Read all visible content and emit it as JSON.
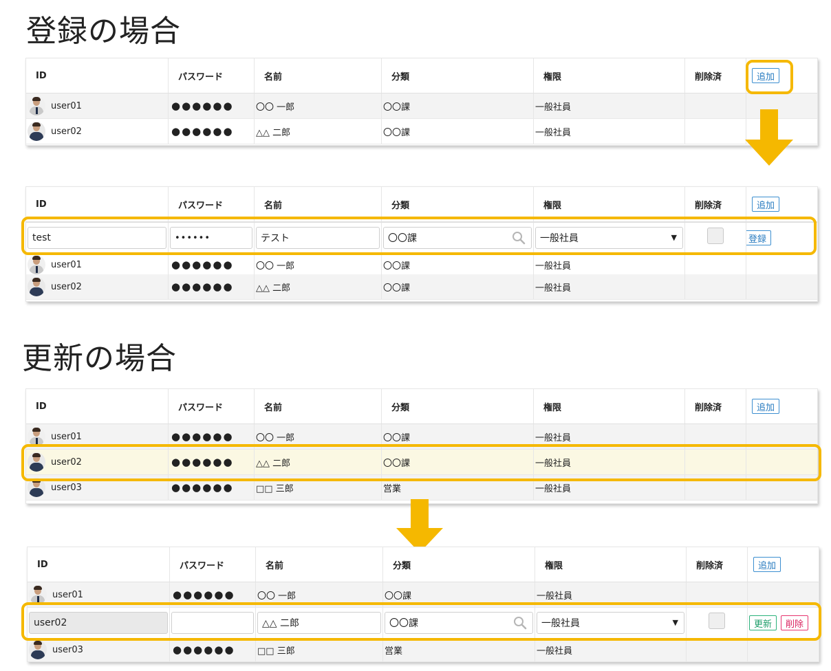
{
  "headings": {
    "register": "登録の場合",
    "update": "更新の場合"
  },
  "columns": [
    "ID",
    "パスワード",
    "名前",
    "分類",
    "権限",
    "削除済"
  ],
  "buttons": {
    "add": "追加",
    "register": "登録",
    "update": "更新",
    "delete": "削除"
  },
  "password_mask": "●●●●●●",
  "password_input_mask": "••••••",
  "users": [
    {
      "id": "user01",
      "name": "〇〇 一郎",
      "category": "〇〇課",
      "role": "一般社員"
    },
    {
      "id": "user02",
      "name": "△△ 二郎",
      "category": "〇〇課",
      "role": "一般社員"
    },
    {
      "id": "user03",
      "name": "□□ 三郎",
      "category": "営業",
      "role": "一般社員"
    }
  ],
  "register_form": {
    "id": "test",
    "name": "テスト",
    "category": "〇〇課",
    "role": "一般社員"
  },
  "update_form": {
    "id": "user02",
    "password": "",
    "name": "△△ 二郎",
    "category": "〇〇課",
    "role": "一般社員"
  },
  "icons": {
    "search": "search-icon",
    "dropdown": "caret-down-icon",
    "arrow": "arrow-down-icon"
  },
  "colors": {
    "highlight": "#f5b800",
    "selected_row": "#fbf8e3",
    "add_button": "#2a7cc0",
    "update_button": "#1f9e6a",
    "delete_button": "#d91f5d"
  }
}
